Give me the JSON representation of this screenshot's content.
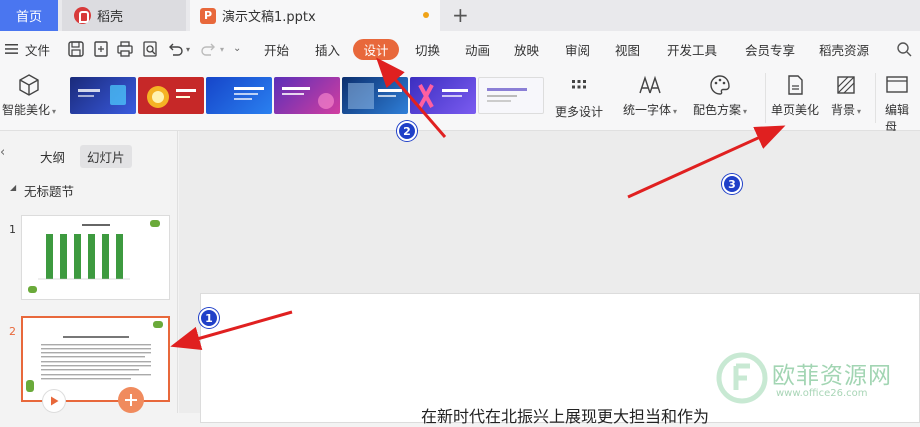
{
  "tabs": [
    {
      "label": "首页"
    },
    {
      "label": "稻壳"
    },
    {
      "label": "演示文稿1.pptx"
    }
  ],
  "new_tab_label": "+",
  "menu": {
    "file_label": "文件",
    "items": [
      "开始",
      "插入",
      "设计",
      "切换",
      "动画",
      "放映",
      "审阅",
      "视图",
      "开发工具",
      "会员专享",
      "稻壳资源"
    ],
    "active": "设计"
  },
  "ribbon": {
    "smart_beautify": "智能美化",
    "more_designs": "更多设计",
    "unify_font": "统一字体",
    "color_scheme": "配色方案",
    "single_page_beautify": "单页美化",
    "background": "背景",
    "edit_master": "编辑母"
  },
  "panel": {
    "tab_outline": "大纲",
    "tab_slides": "幻灯片",
    "section_title": "无标题节",
    "slide_numbers": [
      "1",
      "2"
    ]
  },
  "slide_text": "在新时代在北振兴上展现更大担当和作为",
  "annotations": [
    "1",
    "2",
    "3"
  ],
  "watermark": {
    "text": "欧菲资源网",
    "url": "www.office26.com"
  },
  "colors": {
    "accent": "#e8683b",
    "home_tab": "#4a76f0",
    "arrow": "#e02020",
    "badge": "#2040c8"
  }
}
